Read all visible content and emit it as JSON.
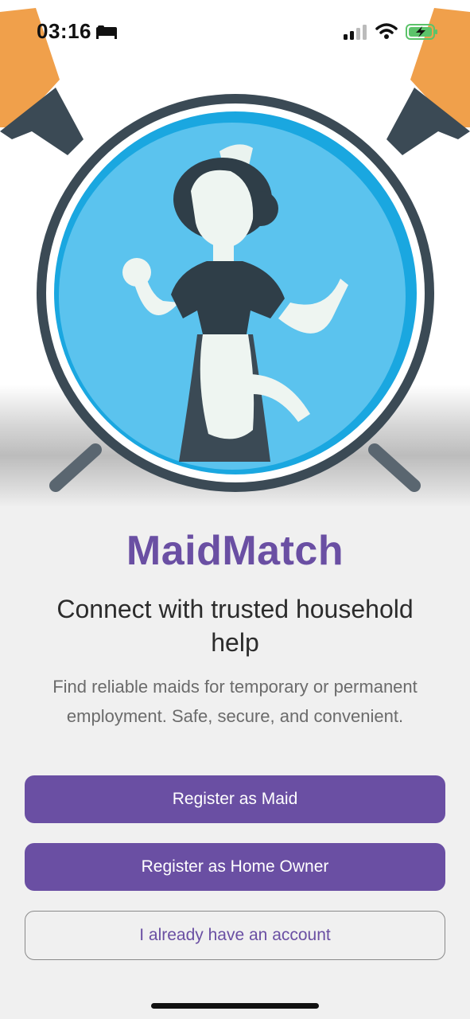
{
  "status_bar": {
    "time": "03:16",
    "icons": [
      "bed-icon",
      "signal-icon",
      "wifi-icon",
      "battery-charging-icon"
    ]
  },
  "hero": {
    "illustration": "maid-clock-illustration"
  },
  "app": {
    "title": "MaidMatch",
    "tagline": "Connect with trusted household help",
    "description": "Find reliable maids for temporary or permanent employment. Safe, secure, and convenient."
  },
  "actions": {
    "register_maid": "Register as Maid",
    "register_owner": "Register as Home Owner",
    "login": "I already have an account"
  },
  "colors": {
    "brand": "#6a4fa3",
    "background": "#f0f0f0",
    "sky_blue": "#5bc3ee",
    "dark_slate": "#3b4a55",
    "bell_orange": "#f0a04b"
  }
}
